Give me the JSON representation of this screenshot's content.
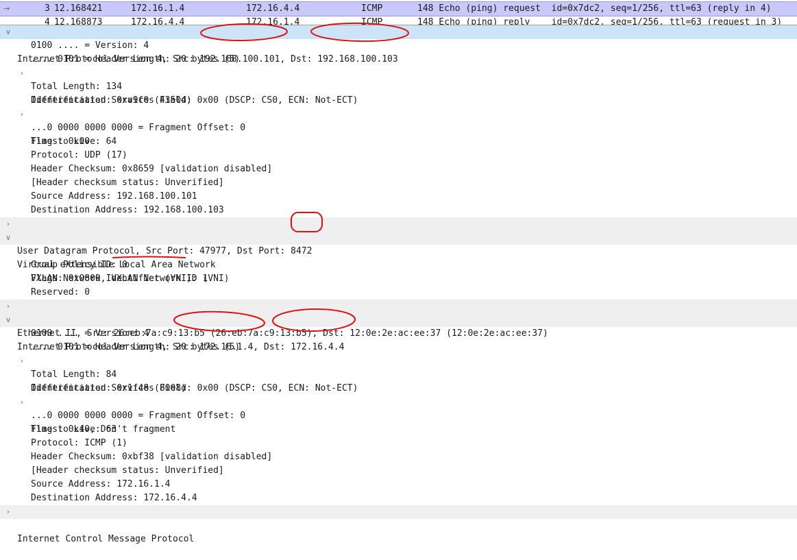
{
  "packet_list": {
    "selected": {
      "no": "3",
      "time": "12.168421",
      "src": "172.16.1.4",
      "dst": "172.16.4.4",
      "proto": "ICMP",
      "info": "148 Echo (ping) request  id=0x7dc2, seq=1/256, ttl=63 (reply in 4)"
    },
    "next_partial": {
      "no": "4",
      "time": "12.168873",
      "src": "172.16.4.4",
      "dst": "172.16.1.4",
      "proto": "ICMP",
      "info": "148 Echo (ping) reply    id=0x7dc2, seq=1/256, ttl=63 (request in 3)"
    }
  },
  "details": {
    "outer_ip": {
      "header": "Internet Protocol Version 4, Src: 192.168.100.101, Dst: 192.168.100.103",
      "version": "0100 .... = Version: 4",
      "hdr_len": ".... 0101 = Header Length: 20 bytes (5)",
      "dsfield": "Differentiated Services Field: 0x00 (DSCP: CS0, ECN: Not-ECT)",
      "total_len": "Total Length: 134",
      "ident": "Identification: 0xa9f0 (43504)",
      "flags": "Flags: 0x00",
      "frag": "...0 0000 0000 0000 = Fragment Offset: 0",
      "ttl": "Time to Live: 64",
      "proto": "Protocol: UDP (17)",
      "checksum": "Header Checksum: 0x8659 [validation disabled]",
      "checksum_status": "[Header checksum status: Unverified]",
      "src": "Source Address: 192.168.100.101",
      "dst": "Destination Address: 192.168.100.103"
    },
    "udp": {
      "header": "User Datagram Protocol, Src Port: 47977, Dst Port: 8472"
    },
    "vxlan": {
      "header": "Virtual eXtensible Local Area Network",
      "flags": "Flags: 0x0800, VXLAN Network ID (VNI)",
      "group_policy": "Group Policy ID: 0",
      "vni": "VXLAN Network Identifier (VNI): 1",
      "reserved": "Reserved: 0"
    },
    "eth": {
      "header": "Ethernet II, Src: 26:eb:7a:c9:13:b5 (26:eb:7a:c9:13:b5), Dst: 12:0e:2e:ac:ee:37 (12:0e:2e:ac:ee:37)"
    },
    "inner_ip": {
      "header": "Internet Protocol Version 4, Src: 172.16.1.4, Dst: 172.16.4.4",
      "version": "0100 .... = Version: 4",
      "hdr_len": ".... 0101 = Header Length: 20 bytes (5)",
      "dsfield": "Differentiated Services Field: 0x00 (DSCP: CS0, ECN: Not-ECT)",
      "total_len": "Total Length: 84",
      "ident": "Identification: 0x1f48 (8008)",
      "flags": "Flags: 0x40, Don't fragment",
      "frag": "...0 0000 0000 0000 = Fragment Offset: 0",
      "ttl": "Time to Live: 63",
      "proto": "Protocol: ICMP (1)",
      "checksum": "Header Checksum: 0xbf38 [validation disabled]",
      "checksum_status": "[Header checksum status: Unverified]",
      "src": "Source Address: 172.16.1.4",
      "dst": "Destination Address: 172.16.4.4"
    },
    "icmp": {
      "header": "Internet Control Message Protocol"
    }
  },
  "icons": {
    "expanded": "chevron-down-icon",
    "collapsed": "chevron-right-icon",
    "row_marker": "related-packet-arrow-icon"
  },
  "colors": {
    "selected_packet_bg": "#c8c8fa",
    "selected_detail_bg": "#cce4f7",
    "section_bg": "#efefef",
    "annotation": "#e01010"
  }
}
